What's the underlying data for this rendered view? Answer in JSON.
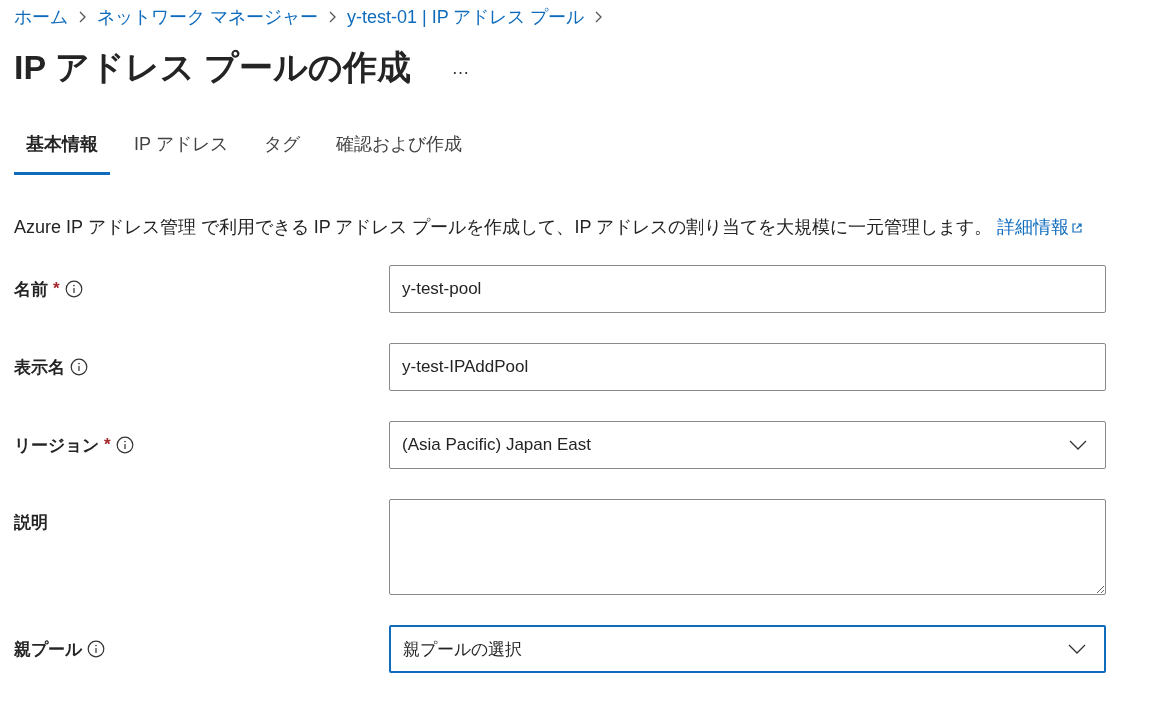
{
  "breadcrumb": [
    {
      "label": "ホーム"
    },
    {
      "label": "ネットワーク マネージャー"
    },
    {
      "label": "y-test-01 | IP アドレス プール"
    }
  ],
  "title": "IP アドレス プールの作成",
  "more_button": "…",
  "tabs": [
    {
      "label": "基本情報",
      "selected": true
    },
    {
      "label": "IP アドレス",
      "selected": false
    },
    {
      "label": "タグ",
      "selected": false
    },
    {
      "label": "確認および作成",
      "selected": false
    }
  ],
  "description": {
    "text": "Azure IP アドレス管理 で利用できる IP アドレス プールを作成して、IP アドレスの割り当てを大規模に一元管理します。",
    "link": "詳細情報"
  },
  "fields": [
    {
      "kind": "text",
      "label": "名前",
      "required_mark": "*",
      "info": true,
      "value": "y-test-pool",
      "focused": false
    },
    {
      "kind": "text",
      "label": "表示名",
      "info": true,
      "value": "y-test-IPAddPool",
      "focused": false
    },
    {
      "kind": "select",
      "label": "リージョン",
      "required_mark": "*",
      "info": true,
      "value": "(Asia Pacific) Japan East",
      "focused": false
    },
    {
      "kind": "textarea",
      "label": "説明",
      "info": false,
      "focused": false
    },
    {
      "kind": "select",
      "label": "親プール",
      "info": true,
      "placeholder": "親プールの選択",
      "focused": true
    }
  ]
}
